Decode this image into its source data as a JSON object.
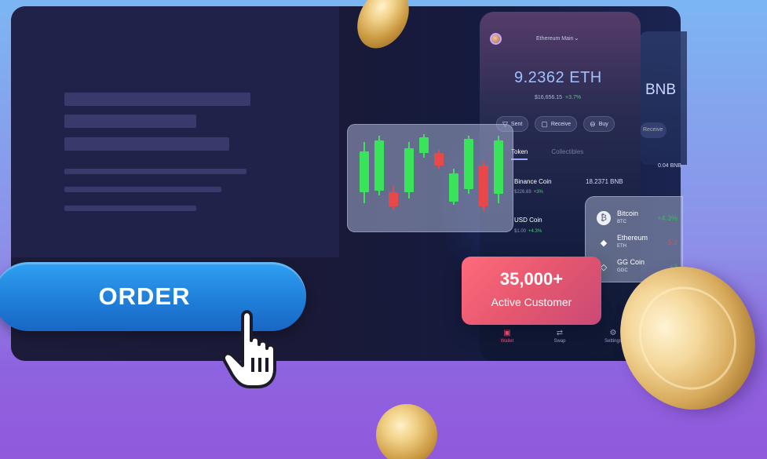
{
  "wallet": {
    "name": "Ethereum Main",
    "balance": "9.2362 ETH",
    "balance_usd": "$16,656.15",
    "balance_change": "+3.7%",
    "actions": [
      {
        "label": "Sent",
        "icon": "send-icon"
      },
      {
        "label": "Receive",
        "icon": "receive-icon"
      },
      {
        "label": "Buy",
        "icon": "buy-icon"
      }
    ],
    "tabs": [
      "Token",
      "Collectibles"
    ],
    "tokens": [
      {
        "name": "Binance Coin",
        "price": "$226.69",
        "change": "+3%",
        "amount": "18.2371 BNB"
      },
      {
        "name": "USD Coin",
        "price": "$1.00",
        "change": "+4.3%",
        "amount": ""
      }
    ],
    "nav": [
      {
        "label": "Wallet",
        "icon": "wallet-icon"
      },
      {
        "label": "Swap",
        "icon": "swap-icon"
      },
      {
        "label": "Settings",
        "icon": "settings-icon"
      }
    ],
    "side_balance": "BNB",
    "side_pill": "Receive",
    "side_amount": "0.04 BNB"
  },
  "crypto_list": [
    {
      "name": "Bitcoin",
      "symbol": "BTC",
      "change": "+4.3%"
    },
    {
      "name": "Ethereum",
      "symbol": "ETH",
      "change": "-5.2"
    },
    {
      "name": "GG Coin",
      "symbol": "GGC",
      "change": "+3"
    }
  ],
  "customer_card": {
    "count": "35,000+",
    "label": "Active Customer"
  },
  "cta": {
    "label": "ORDER"
  },
  "colors": {
    "accent_blue": "#1f7fd9",
    "customer_card": "#e5576f",
    "positive": "#39e35a",
    "negative": "#e8484a"
  }
}
